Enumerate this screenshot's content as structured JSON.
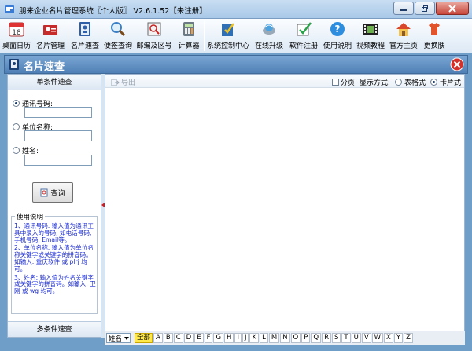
{
  "window": {
    "title": "朋来企业名片管理系统〖个人版〗 V2.6.1.52【未注册】"
  },
  "toolbar": {
    "items": [
      {
        "label": "桌面日历",
        "icon": "calendar-icon"
      },
      {
        "label": "名片管理",
        "icon": "card-manage-icon"
      },
      {
        "label": "名片速查",
        "icon": "card-search-icon"
      },
      {
        "label": "便签查询",
        "icon": "memo-search-icon"
      },
      {
        "label": "邮编及区号",
        "icon": "postcode-icon"
      },
      {
        "label": "计算器",
        "icon": "calculator-icon"
      },
      {
        "label": "系统控制中心",
        "icon": "control-center-icon"
      },
      {
        "label": "在线升级",
        "icon": "online-upgrade-icon"
      },
      {
        "label": "软件注册",
        "icon": "register-icon"
      },
      {
        "label": "使用说明",
        "icon": "help-icon"
      },
      {
        "label": "视频教程",
        "icon": "video-icon"
      },
      {
        "label": "官方主页",
        "icon": "home-icon"
      },
      {
        "label": "更换肤",
        "icon": "skin-icon"
      }
    ]
  },
  "panel": {
    "title": "名片速查"
  },
  "left": {
    "single_title": "单条件速查",
    "options": [
      {
        "label": "通讯号码:",
        "selected": true,
        "value": ""
      },
      {
        "label": "单位名称:",
        "selected": false,
        "value": ""
      },
      {
        "label": "姓名:",
        "selected": false,
        "value": ""
      }
    ],
    "search_label": "查询",
    "help_title": "使用说明",
    "help_items": [
      "1、通讯号码: 输入值为通讯工具中录入的号码, 如电话号码, 手机号码, Email等。",
      "2、单位名称: 输入值为单位名称关键字或关键字的拼音码。如输入: 重庆软件 或 plrj 均可。",
      "3、姓名: 输入值为姓名关键字或关键字的拼音码。如输入: 卫刚 或 wg 均可。"
    ],
    "multi_title": "多条件速查"
  },
  "right": {
    "export_label": "导出",
    "paging_label": "分页",
    "display_mode_label": "显示方式:",
    "table_mode_label": "表格式",
    "card_mode_label": "卡片式",
    "paging_checked": false,
    "display_mode": "card"
  },
  "indexbar": {
    "field": "姓名",
    "letters": [
      "全部",
      "A",
      "B",
      "C",
      "D",
      "E",
      "F",
      "G",
      "H",
      "I",
      "J",
      "K",
      "L",
      "M",
      "N",
      "O",
      "P",
      "Q",
      "R",
      "S",
      "T",
      "U",
      "V",
      "W",
      "X",
      "Y",
      "Z"
    ],
    "active": "全部"
  }
}
